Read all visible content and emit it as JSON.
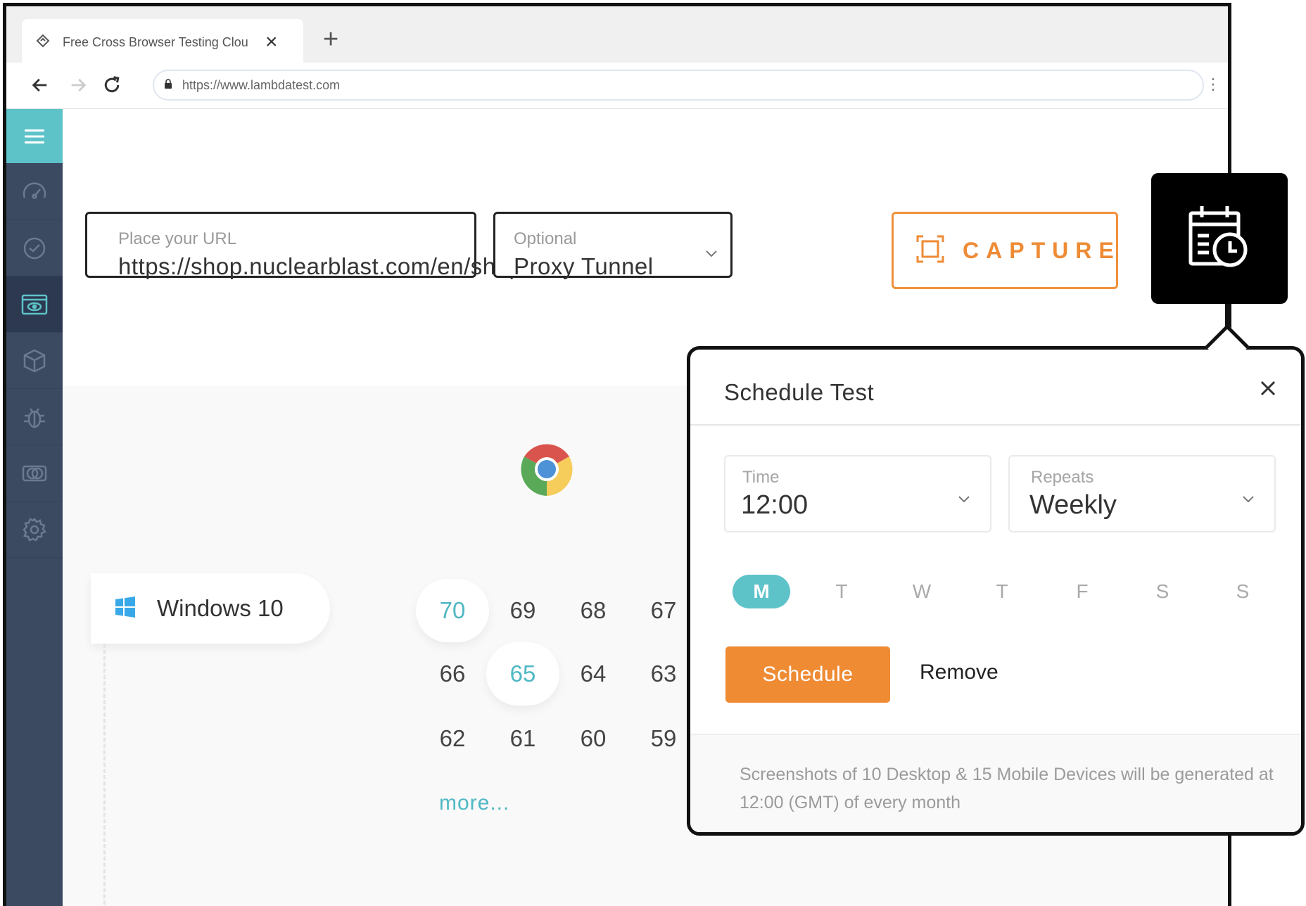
{
  "browser": {
    "tab_title": "Free Cross Browser Testing Clou",
    "url": "https://www.lambdatest.com"
  },
  "sidebar": {
    "items": [
      {
        "icon": "hamburger-menu-icon"
      },
      {
        "icon": "speedometer-icon"
      },
      {
        "icon": "realtime-test-icon"
      },
      {
        "icon": "visual-screenshot-icon"
      },
      {
        "icon": "box-icon"
      },
      {
        "icon": "bug-icon"
      },
      {
        "icon": "compare-icon"
      },
      {
        "icon": "gear-icon"
      }
    ]
  },
  "url_field": {
    "label": "Place your URL",
    "value": "https://shop.nuclearblast.com/en/shop"
  },
  "proxy_field": {
    "label": "Optional",
    "value": "Proxy Tunnel"
  },
  "capture_button": {
    "label": "CAPTURE",
    "color": "#ee8b35"
  },
  "schedule_icon_button": {
    "icon": "schedule-calendar-clock-icon"
  },
  "browser_logo": {
    "icon": "chrome-logo-icon"
  },
  "os": {
    "name": "Windows 10",
    "icon": "windows-logo-icon"
  },
  "versions": {
    "rows": [
      [
        "70",
        "69",
        "68",
        "67"
      ],
      [
        "66",
        "65",
        "64",
        "63"
      ],
      [
        "62",
        "61",
        "60",
        "59"
      ]
    ],
    "selected": [
      "70",
      "65"
    ],
    "more_label": "more..."
  },
  "schedule_popover": {
    "title": "Schedule Test",
    "time_label": "Time",
    "time_value": "12:00",
    "repeats_label": "Repeats",
    "repeats_value": "Weekly",
    "days": [
      "M",
      "T",
      "W",
      "T",
      "F",
      "S",
      "S"
    ],
    "selected_day": "M",
    "schedule_label": "Schedule",
    "remove_label": "Remove",
    "note": "Screenshots  of 10 Desktop & 15 Mobile Devices will be generated at 12:00 (GMT) of every month",
    "accent_color": "#5ec2c9",
    "button_color": "#ef8b33"
  }
}
